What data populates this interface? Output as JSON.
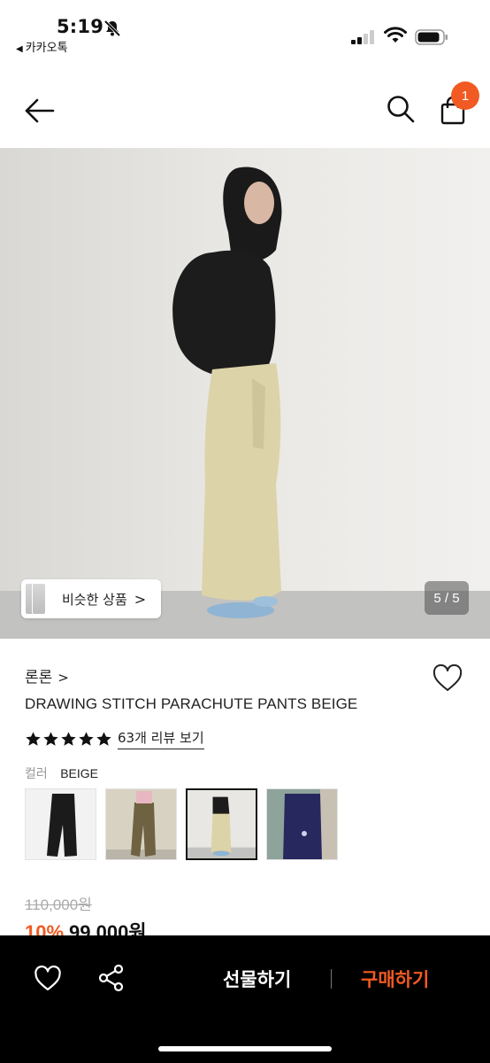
{
  "status_bar": {
    "time": "5:19",
    "back_app": "카카오톡",
    "icons": [
      "bell-slash-icon",
      "signal-icon",
      "wifi-icon",
      "battery-icon"
    ]
  },
  "nav": {
    "back_icon": "arrow-left-icon",
    "search_icon": "search-icon",
    "cart_icon": "shopping-bag-icon",
    "cart_count": "1"
  },
  "gallery": {
    "similar_label": "비슷한 상품",
    "similar_chevron": ">",
    "counter": "5 / 5"
  },
  "product": {
    "brand": "론론",
    "brand_chevron": ">",
    "title": "DRAWING STITCH PARACHUTE PANTS BEIGE",
    "rating": 5,
    "review_link": "63개 리뷰 보기",
    "color_label": "컬러",
    "color_value": "BEIGE",
    "swatches": [
      "black",
      "khaki",
      "beige",
      "navy"
    ],
    "selected_swatch": "beige",
    "original_price": "110,000원",
    "discount": "10%",
    "sale_price": "99,000원"
  },
  "bottom_bar": {
    "gift_label": "선물하기",
    "buy_label": "구매하기"
  },
  "colors": {
    "accent": "#f15a22",
    "bar_bg": "#000000"
  }
}
